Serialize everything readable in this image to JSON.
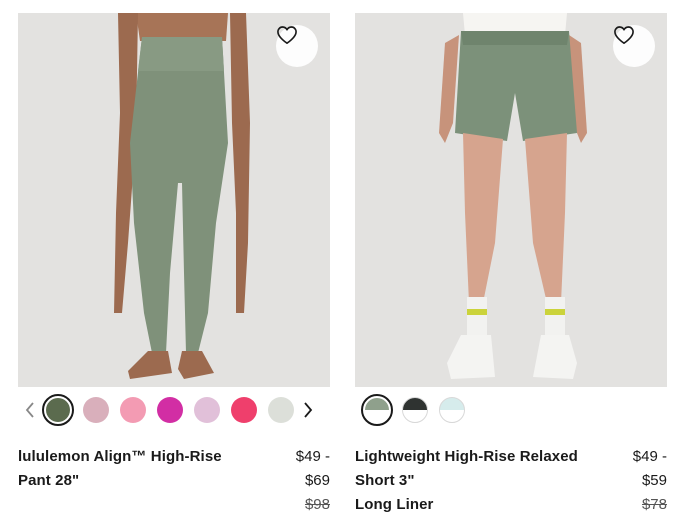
{
  "products": [
    {
      "title_line1": "lululemon Align™ High-Rise",
      "title_line2": "Pant 28\"",
      "price_range_low": "$49 -",
      "price_range_high": "$69",
      "original_price": "$98",
      "swatch_colors": [
        "#5b6b4e",
        "#d9afbb",
        "#f39bb3",
        "#d22ea4",
        "#e1c0d9",
        "#ef3f6c",
        "#dcdfd9"
      ],
      "selected_swatch": 0
    },
    {
      "title_line1": "Lightweight High-Rise Relaxed",
      "title_line2": "Short 3\"",
      "title_line3": "Long Liner",
      "price_range_low": "$49 -",
      "price_range_high": "$59",
      "original_price": "$78",
      "swatches": [
        {
          "top": "#8fa08c",
          "bottom": "#ffffff"
        },
        {
          "top": "#2f3331",
          "bottom": "#ffffff"
        },
        {
          "top": "#d6ecec",
          "bottom": "#ffffff"
        }
      ],
      "selected_swatch": 0
    }
  ],
  "icons": {
    "wishlist": "heart-icon",
    "prev": "chevron-left-icon",
    "next": "chevron-right-icon"
  }
}
